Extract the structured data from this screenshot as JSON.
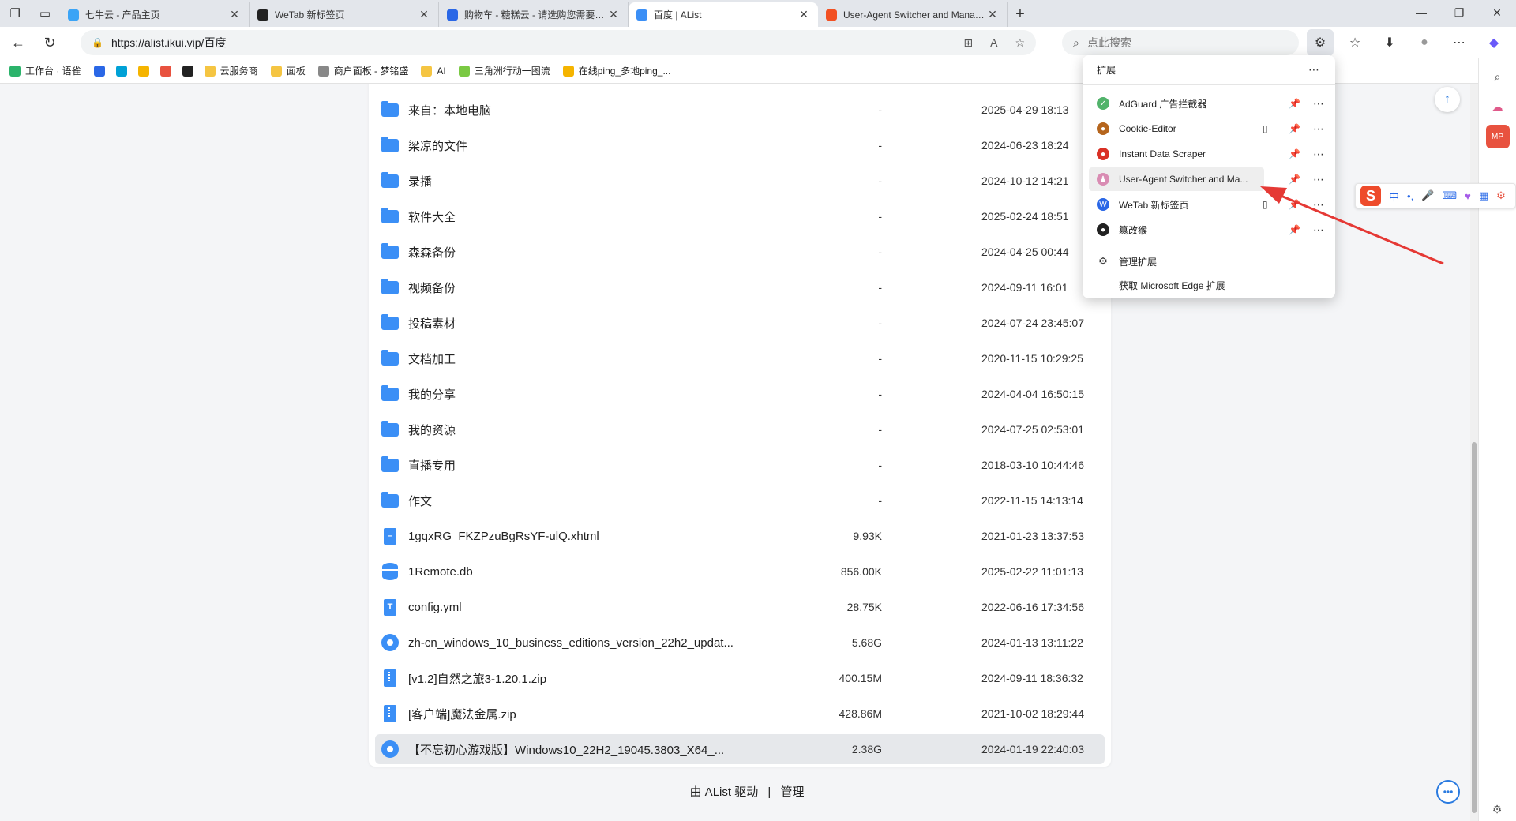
{
  "tabs": [
    {
      "title": "七牛云 - 产品主页",
      "favcolor": "#3ba4f6",
      "active": false
    },
    {
      "title": "WeTab 新标签页",
      "favcolor": "#222222",
      "active": false
    },
    {
      "title": "购物车 - 糖糕云 - 请选购您需要的产品",
      "favcolor": "#2a67e6",
      "active": false
    },
    {
      "title": "百度 | AList",
      "favcolor": "#3b8ff6",
      "active": true
    },
    {
      "title": "User-Agent Switcher and Manager",
      "favcolor": "#f25022",
      "active": false
    }
  ],
  "address": {
    "url": "https://alist.ikui.vip/百度"
  },
  "search": {
    "placeholder": "点此搜索"
  },
  "bookmarks": [
    {
      "label": "工作台 · 语雀",
      "color": "#2bb36b"
    },
    {
      "label": "",
      "color": "#2a67e6"
    },
    {
      "label": "",
      "color": "#00a1d6"
    },
    {
      "label": "",
      "color": "#f5b400"
    },
    {
      "label": "",
      "color": "#e8523f"
    },
    {
      "label": "",
      "color": "#222222"
    },
    {
      "label": "云服务商",
      "color": "#f5c542"
    },
    {
      "label": "面板",
      "color": "#f5c542"
    },
    {
      "label": "商户面板 - 梦铭盛",
      "color": "#888888"
    },
    {
      "label": "AI",
      "color": "#f5c542"
    },
    {
      "label": "三角洲行动一图流",
      "color": "#7ac943"
    },
    {
      "label": "在线ping_多地ping_...",
      "color": "#f5b400"
    }
  ],
  "files": [
    {
      "name": "来自：本地电脑",
      "size": "-",
      "date": "2025-04-29 18:13",
      "type": "folder"
    },
    {
      "name": "梁凉的文件",
      "size": "-",
      "date": "2024-06-23 18:24",
      "type": "folder"
    },
    {
      "name": "录播",
      "size": "-",
      "date": "2024-10-12 14:21",
      "type": "folder"
    },
    {
      "name": "软件大全",
      "size": "-",
      "date": "2025-02-24 18:51",
      "type": "folder"
    },
    {
      "name": "森森备份",
      "size": "-",
      "date": "2024-04-25 00:44",
      "type": "folder"
    },
    {
      "name": "视频备份",
      "size": "-",
      "date": "2024-09-11 16:01",
      "type": "folder"
    },
    {
      "name": "投稿素材",
      "size": "-",
      "date": "2024-07-24 23:45:07",
      "type": "folder"
    },
    {
      "name": "文档加工",
      "size": "-",
      "date": "2020-11-15 10:29:25",
      "type": "folder"
    },
    {
      "name": "我的分享",
      "size": "-",
      "date": "2024-04-04 16:50:15",
      "type": "folder"
    },
    {
      "name": "我的资源",
      "size": "-",
      "date": "2024-07-25 02:53:01",
      "type": "folder"
    },
    {
      "name": "直播专用",
      "size": "-",
      "date": "2018-03-10 10:44:46",
      "type": "folder"
    },
    {
      "name": "作文",
      "size": "-",
      "date": "2022-11-15 14:13:14",
      "type": "folder"
    },
    {
      "name": "1gqxRG_FKZPzuBgRsYF-ulQ.xhtml",
      "size": "9.93K",
      "date": "2021-01-23 13:37:53",
      "type": "file"
    },
    {
      "name": "1Remote.db",
      "size": "856.00K",
      "date": "2025-02-22 11:01:13",
      "type": "db"
    },
    {
      "name": "config.yml",
      "size": "28.75K",
      "date": "2022-06-16 17:34:56",
      "type": "text"
    },
    {
      "name": "zh-cn_windows_10_business_editions_version_22h2_updat...",
      "size": "5.68G",
      "date": "2024-01-13 13:11:22",
      "type": "disc"
    },
    {
      "name": "[v1.2]自然之旅3-1.20.1.zip",
      "size": "400.15M",
      "date": "2024-09-11 18:36:32",
      "type": "zip"
    },
    {
      "name": "[客户端]魔法金属.zip",
      "size": "428.86M",
      "date": "2021-10-02 18:29:44",
      "type": "zip"
    },
    {
      "name": "【不忘初心游戏版】Windows10_22H2_19045.3803_X64_...",
      "size": "2.38G",
      "date": "2024-01-19 22:40:03",
      "type": "disc"
    }
  ],
  "footer": {
    "powered": "由 AList 驱动",
    "sep": "|",
    "manage": "管理"
  },
  "extensions": {
    "title": "扩展",
    "items": [
      {
        "name": "AdGuard 广告拦截器",
        "color": "#52b36b",
        "glyph": "✓"
      },
      {
        "name": "Cookie-Editor",
        "color": "#b5651d",
        "glyph": "●"
      },
      {
        "name": "Instant Data Scraper",
        "color": "#d93025",
        "glyph": "●"
      },
      {
        "name": "User-Agent Switcher and Ma...",
        "color": "#d98cb3",
        "glyph": "♟"
      },
      {
        "name": "WeTab 新标签页",
        "color": "#2a67e6",
        "glyph": "W"
      },
      {
        "name": "篡改猴",
        "color": "#222222",
        "glyph": "●"
      }
    ],
    "manage": "管理扩展",
    "get": "获取 Microsoft Edge 扩展"
  },
  "ime": {
    "logo": "S",
    "mode": "中",
    "punct": "•,"
  }
}
